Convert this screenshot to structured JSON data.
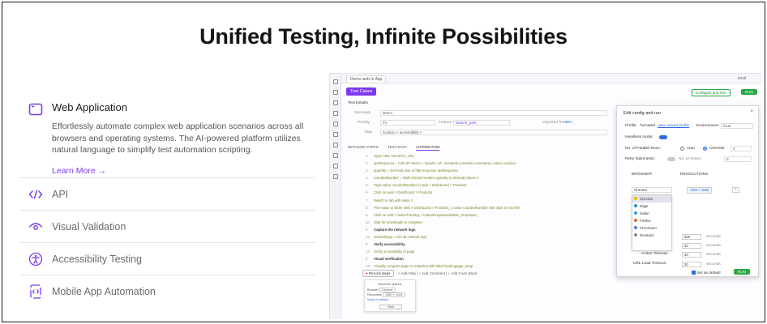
{
  "headline": "Unified Testing, Infinite Possibilities",
  "features": [
    {
      "title": "Web Application",
      "description": "Effortlessly automate complex web application scenarios across all browsers and operating systems. The AI-powered platform utilizes natural language to simplify test automation scripting.",
      "link": "Learn More →"
    },
    {
      "title": "API"
    },
    {
      "title": "Visual Validation"
    },
    {
      "title": "Accessibility Testing"
    },
    {
      "title": "Mobile App Automation"
    }
  ],
  "app": {
    "tab": "Demo web In App",
    "env": "local",
    "test_cases_button": "Test Cases",
    "test_details_label": "Test Details",
    "configure_button": "Configure and Run",
    "run_button": "RUN",
    "summary_label": "Summary",
    "summary_value": "Demo",
    "priority_label": "Priority",
    "priority_value": "P1",
    "feature_label": "Feature",
    "feature_value": "Search_path",
    "imported_label": "Imported from",
    "imported_value": "JRA",
    "tags_label": "Tags",
    "tags_value": "location × accessibility ×",
    "tabs": [
      "DETAILED STEPS",
      "TEST DATA",
      "AUTOMATION"
    ],
    "steps": [
      "Open URL  site.NITH_URL",
      "apiResponse  =  Call API  Demo + trivials  |  url: constants.constant1.username  |  value: product",
      "quantity  =  Get body text of http response  apiResponse",
      "roundedNumber  =  Math.Round number  quantity  to decimal places  2",
      "Input value  roundedNumber  in  web > Dashboard > Products",
      "Click on  web > Dashboard > Products",
      "Switch to tab with index  1",
      "Pick value in slider  web > Dashboard > Products_1  value  roundedNumber  with start  10  end  99",
      "Click on  web > SalesTracking > buttonDropdownWelde_Dropdown_",
      "Wait for downloads to complete",
      "Capture the network logs",
      "networklogs  =  Get all network logs",
      "Verify accessibility",
      "Verify accessibility of page",
      "Visual verification",
      "Visually compare page to snapshot with label  landingpage_snap"
    ],
    "record_button": "Record steps",
    "add_step": "+ Add Step",
    "add_comment": "+ Add Comment",
    "add_code_block": "+ Add Code Block",
    "popup": {
      "title": "Recorder options",
      "browser_label": "Browser",
      "browser_value": "Chrome",
      "resolution_label": "Resolution",
      "resolution_value": "1280 × 1024",
      "link": "Mode to default",
      "button": "Start"
    },
    "dialog": {
      "title": "Edit config and run",
      "profile_label": "Profile:",
      "profile_value": "Turnated",
      "profile_link": "open saved profile",
      "environment_label": "Environment",
      "environment_value": "local",
      "headless_label": "Headless mode:",
      "parallel_label": "No. of Parallel Runs:",
      "auto_label": "Auto",
      "override_label": "Override",
      "override_value": "4",
      "retry_label": "Retry failed tests:",
      "retries_label": "No. of retries",
      "retries_value": "0",
      "browser_header": "BROWSER",
      "resolution_header": "RESOLUTIONS",
      "resolution_value": "1920 × 1080",
      "browsers": [
        "Chrome",
        "Chrome",
        "Edge",
        "Safari",
        "Firefox",
        "Chromium",
        "Emulator"
      ],
      "timeout1_value": "600",
      "timeout2_value": "20",
      "action_timeout_label": "Action Timeout:",
      "action_timeout_value": "20",
      "url_timeout_label": "URL Load Timeout:",
      "url_timeout_value": "20",
      "seconds": "seconds",
      "set_default_label": "Set as default",
      "run_button": "RUN"
    },
    "colors": {
      "accent": "#7c3aed",
      "run": "#28a745",
      "toggle": "#2d6cdf"
    }
  }
}
